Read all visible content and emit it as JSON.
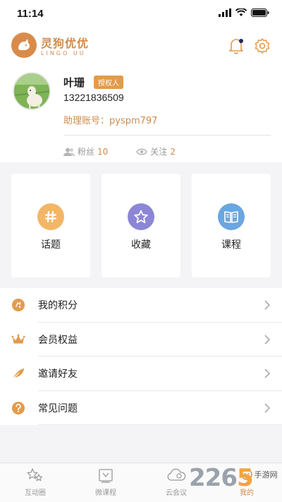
{
  "status": {
    "time": "11:14"
  },
  "app": {
    "logo_title": "灵狗优优",
    "logo_sub": "LINGO UU"
  },
  "profile": {
    "name": "叶珊",
    "badge": "授权人",
    "phone": "13221836509",
    "assistant_account": "助理账号：pyspm797",
    "fans_label": "粉丝",
    "fans_count": "10",
    "follow_label": "关注",
    "follow_count": "2"
  },
  "cards": [
    {
      "label": "话题",
      "icon": "hash-icon",
      "color": "#f3b667"
    },
    {
      "label": "收藏",
      "icon": "star-icon",
      "color": "#8c86d6"
    },
    {
      "label": "课程",
      "icon": "book-icon",
      "color": "#6aa6e0"
    }
  ],
  "menu": [
    {
      "label": "我的积分",
      "icon": "points-icon"
    },
    {
      "label": "会员权益",
      "icon": "crown-icon"
    },
    {
      "label": "邀请好友",
      "icon": "feather-icon"
    },
    {
      "label": "常见问题",
      "icon": "question-icon"
    }
  ],
  "tabs": [
    {
      "label": "互动圈",
      "icon": "stars-icon"
    },
    {
      "label": "微课程",
      "icon": "course-icon"
    },
    {
      "label": "云会议",
      "icon": "cloud-icon"
    },
    {
      "label": "我的",
      "icon": "profile-icon",
      "active": true
    }
  ],
  "watermark": {
    "number_a": "226",
    "number_b": "5",
    "text": "手游网"
  },
  "colors": {
    "accent": "#d08b4d",
    "background": "#f4f4f6"
  }
}
